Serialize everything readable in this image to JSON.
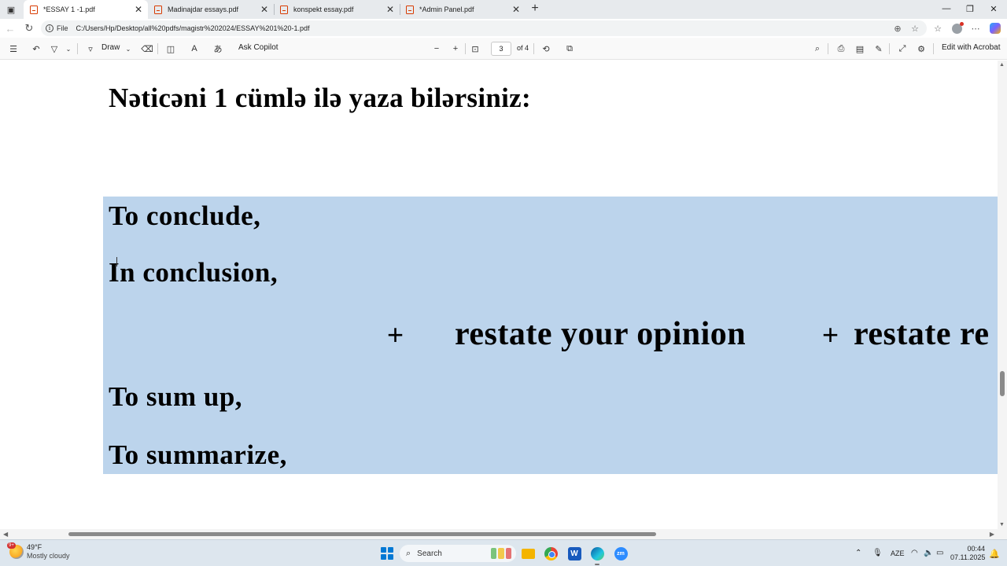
{
  "browser": {
    "tabs": [
      {
        "title": "*ESSAY 1 -1.pdf",
        "active": true
      },
      {
        "title": "Madinajdar essays.pdf",
        "active": false
      },
      {
        "title": "konspekt essay.pdf",
        "active": false
      },
      {
        "title": "*Admin Panel.pdf",
        "active": false
      }
    ],
    "address": {
      "scheme_label": "File",
      "url": "C:/Users/Hp/Desktop/all%20pdfs/magistr%202024/ESSAY%201%20-1.pdf"
    }
  },
  "pdf_toolbar": {
    "draw_label": "Draw",
    "ask_copilot_label": "Ask Copilot",
    "page_current": "3",
    "page_total": "of 4",
    "edit_acrobat_label": "Edit with Acrobat"
  },
  "document": {
    "heading": "Nəticəni 1 cümlə ilə yaza bilərsiniz:",
    "phrases": [
      "To conclude,",
      "In conclusion,",
      "To sum up,",
      "To summarize,"
    ],
    "plus_1": "+",
    "restate_opinion": "restate your opinion",
    "plus_2": "+",
    "restate_partial": "restate re"
  },
  "taskbar": {
    "weather_badge": "9+",
    "weather_temp": "49°F",
    "weather_condition": "Mostly cloudy",
    "search_placeholder": "Search",
    "language": "AZE",
    "time": "00:44",
    "date": "07.11.2025"
  },
  "colors": {
    "selection": "#bcd4ec",
    "tabstrip": "#e7eaed",
    "taskbar": "#dde6ee",
    "pdf_icon": "#d83b01"
  }
}
